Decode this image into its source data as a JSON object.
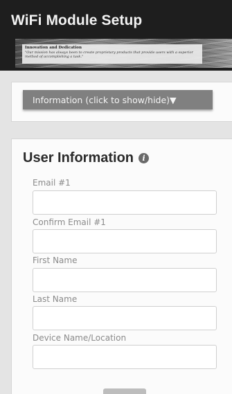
{
  "header": {
    "title": "WiFi Module Setup",
    "banner": {
      "heading": "Innovation and Dedication",
      "quote": "\"Our mission has always been to create proprietary products that provide users with a superior method of accomplishing a task.\""
    }
  },
  "information": {
    "toggle_label": "Information (click to show/hide)▼"
  },
  "user_info": {
    "title": "User Information",
    "info_icon": "info-circle-icon",
    "fields": [
      {
        "label": "Email #1",
        "value": "",
        "placeholder": ""
      },
      {
        "label": "Confirm Email #1",
        "value": "",
        "placeholder": ""
      },
      {
        "label": "First Name",
        "value": "",
        "placeholder": ""
      },
      {
        "label": "Last Name",
        "value": "",
        "placeholder": ""
      },
      {
        "label": "Device Name/Location",
        "value": "",
        "placeholder": ""
      }
    ]
  },
  "colors": {
    "header_bg": "#1e1e1e",
    "toggle_bg": "#808080",
    "page_bg": "#e4e4e4"
  }
}
